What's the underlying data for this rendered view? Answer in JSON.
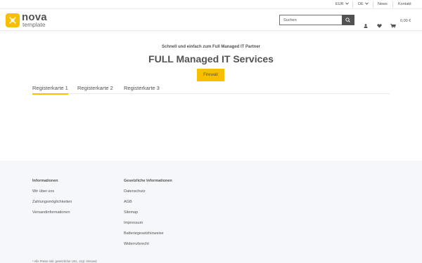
{
  "topbar": {
    "currency": "EUR",
    "language": "DE",
    "news": "News",
    "contact": "Kontakt"
  },
  "header": {
    "logo_name": "nova",
    "logo_sub": "template",
    "search_placeholder": "Suchen",
    "cart_total": "0,00 €"
  },
  "main": {
    "subtitle": "Schnell und einfach zum Full Managed IT Partner",
    "title": "FULL Managed IT Services",
    "cta_label": "Firewall",
    "tabs": [
      {
        "label": "Registerkarte 1"
      },
      {
        "label": "Registerkarte 2"
      },
      {
        "label": "Registerkarte 3"
      }
    ]
  },
  "footer": {
    "col1": {
      "title": "Informationen",
      "links": [
        "Wir über uns",
        "Zahlungsmöglichkeiten",
        "Versandinformationen"
      ]
    },
    "col2": {
      "title": "Gesetzliche Informationen",
      "links": [
        "Datenschutz",
        "AGB",
        "Sitemap",
        "Impressum",
        "Batteriegesetzhinweise",
        "Widerrufsrecht"
      ]
    },
    "note_prefix": "* Alle Preise inkl. gesetzlicher USt., zzgl.",
    "note_link": "Versand"
  },
  "colors": {
    "accent": "#f8bf00",
    "text": "#525252",
    "footer_bg": "#f5f7fa"
  }
}
